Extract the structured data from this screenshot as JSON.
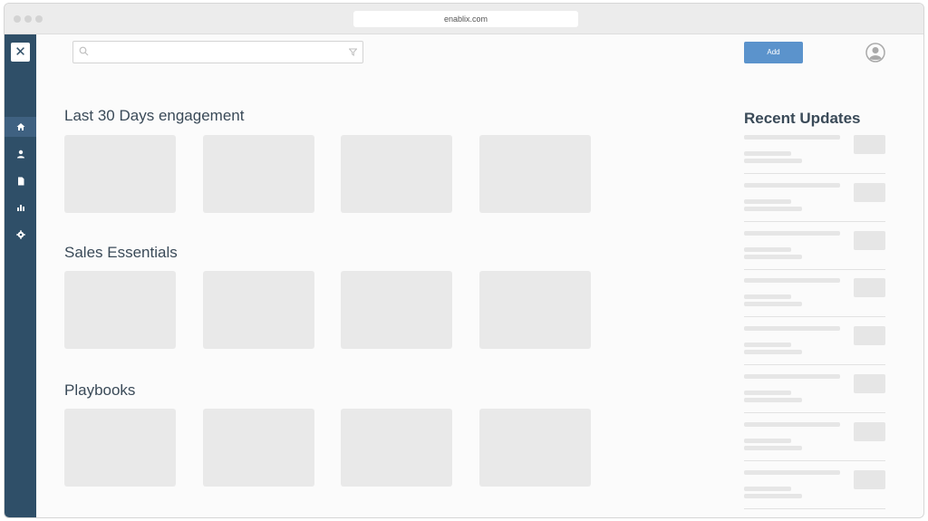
{
  "browser": {
    "url": "enablix.com"
  },
  "app": {
    "logo_glyph": "✕",
    "nav": [
      {
        "name": "home",
        "icon": "home-icon",
        "active": true
      },
      {
        "name": "users",
        "icon": "user-icon",
        "active": false
      },
      {
        "name": "documents",
        "icon": "document-icon",
        "active": false
      },
      {
        "name": "analytics",
        "icon": "bar-chart-icon",
        "active": false
      },
      {
        "name": "settings",
        "icon": "gear-icon",
        "active": false
      }
    ],
    "colors": {
      "sidebar": "#2f4f68",
      "sidebar_active": "#3f6181",
      "accent": "#5b93cc",
      "placeholder": "#e9e9e9"
    }
  },
  "header": {
    "search_placeholder": "",
    "add_button_label": "Add"
  },
  "sections": [
    {
      "title": "Last 30 Days engagement"
    },
    {
      "title": "Sales Essentials"
    },
    {
      "title": "Playbooks"
    }
  ],
  "recent_updates": {
    "title": "Recent Updates"
  }
}
